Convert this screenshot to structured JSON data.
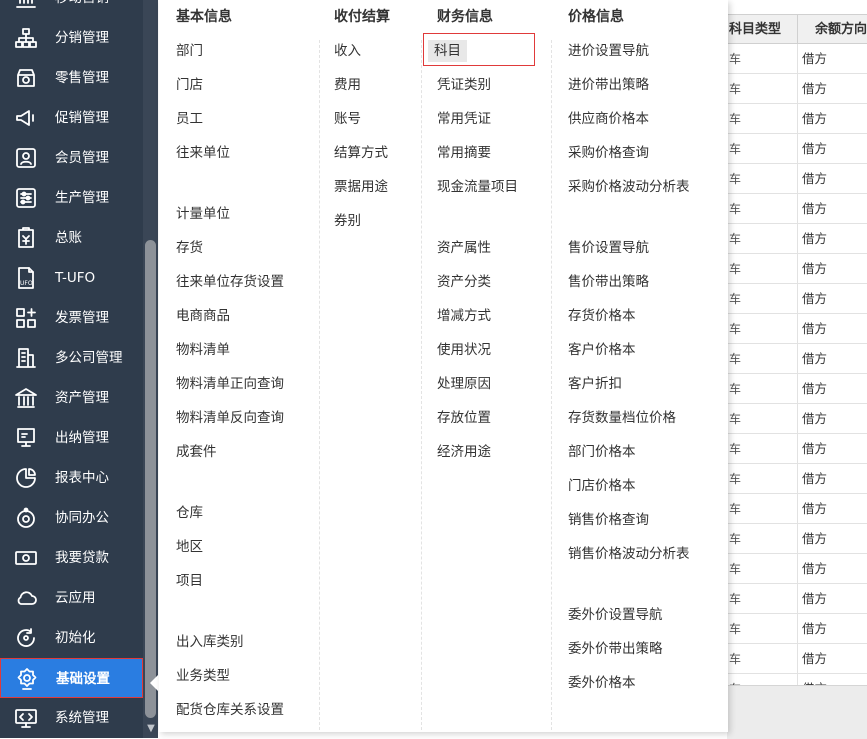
{
  "sidebar": {
    "items": [
      {
        "label": "移动营销",
        "icon": "chart-icon"
      },
      {
        "label": "分销管理",
        "icon": "hierarchy-icon"
      },
      {
        "label": "零售管理",
        "icon": "store-icon"
      },
      {
        "label": "促销管理",
        "icon": "megaphone-icon"
      },
      {
        "label": "会员管理",
        "icon": "member-card-icon"
      },
      {
        "label": "生产管理",
        "icon": "sliders-icon"
      },
      {
        "label": "总账",
        "icon": "ledger-icon"
      },
      {
        "label": "T-UFO",
        "icon": "ufo-file-icon"
      },
      {
        "label": "发票管理",
        "icon": "grid-plus-icon"
      },
      {
        "label": "多公司管理",
        "icon": "building-icon"
      },
      {
        "label": "资产管理",
        "icon": "bank-icon"
      },
      {
        "label": "出纳管理",
        "icon": "cashier-icon"
      },
      {
        "label": "报表中心",
        "icon": "pie-chart-icon"
      },
      {
        "label": "协同办公",
        "icon": "collaboration-icon"
      },
      {
        "label": "我要贷款",
        "icon": "money-icon"
      },
      {
        "label": "云应用",
        "icon": "cloud-icon"
      },
      {
        "label": "初始化",
        "icon": "refresh-icon"
      },
      {
        "label": "基础设置",
        "icon": "settings-gear-icon"
      },
      {
        "label": "系统管理",
        "icon": "code-monitor-icon"
      }
    ],
    "active_index": 17
  },
  "colors": {
    "sidebar_bg": "#2f3c4c",
    "active_bg": "#2a7de1",
    "highlight_border": "#e03a3a"
  },
  "background_table": {
    "headers": [
      "科目类型",
      "余额方向"
    ],
    "col1_fragment": "车",
    "row_values": [
      "借方",
      "借方",
      "借方",
      "借方",
      "借方",
      "借方",
      "借方",
      "借方",
      "借方",
      "借方",
      "借方",
      "借方",
      "借方",
      "借方",
      "借方",
      "借方",
      "借方",
      "借方",
      "借方",
      "借方",
      "借方",
      "借方"
    ]
  },
  "mega_menu": {
    "highlighted_item": "科目",
    "columns": [
      {
        "title": "基本信息",
        "groups": [
          [
            "部门",
            "门店",
            "员工",
            "往来单位"
          ],
          [
            "计量单位",
            "存货",
            "往来单位存货设置",
            "电商商品",
            "物料清单",
            "物料清单正向查询",
            "物料清单反向查询",
            "成套件"
          ],
          [
            "仓库",
            "地区",
            "项目"
          ],
          [
            "出入库类别",
            "业务类型",
            "配货仓库关系设置"
          ]
        ]
      },
      {
        "title": "收付结算",
        "groups": [
          [
            "收入",
            "费用",
            "账号",
            "结算方式",
            "票据用途",
            "券别"
          ]
        ]
      },
      {
        "title": "财务信息",
        "groups": [
          [
            "科目",
            "凭证类别",
            "常用凭证",
            "常用摘要",
            "现金流量项目"
          ],
          [
            "资产属性",
            "资产分类",
            "增减方式",
            "使用状况",
            "处理原因",
            "存放位置",
            "经济用途"
          ]
        ]
      },
      {
        "title": "价格信息",
        "groups": [
          [
            "进价设置导航",
            "进价带出策略",
            "供应商价格本",
            "采购价格查询",
            "采购价格波动分析表"
          ],
          [
            "售价设置导航",
            "售价带出策略",
            "存货价格本",
            "客户价格本",
            "客户折扣",
            "存货数量档位价格",
            "部门价格本",
            "门店价格本",
            "销售价格查询",
            "销售价格波动分析表"
          ],
          [
            "委外价设置导航",
            "委外价带出策略",
            "委外价格本"
          ]
        ]
      }
    ]
  }
}
